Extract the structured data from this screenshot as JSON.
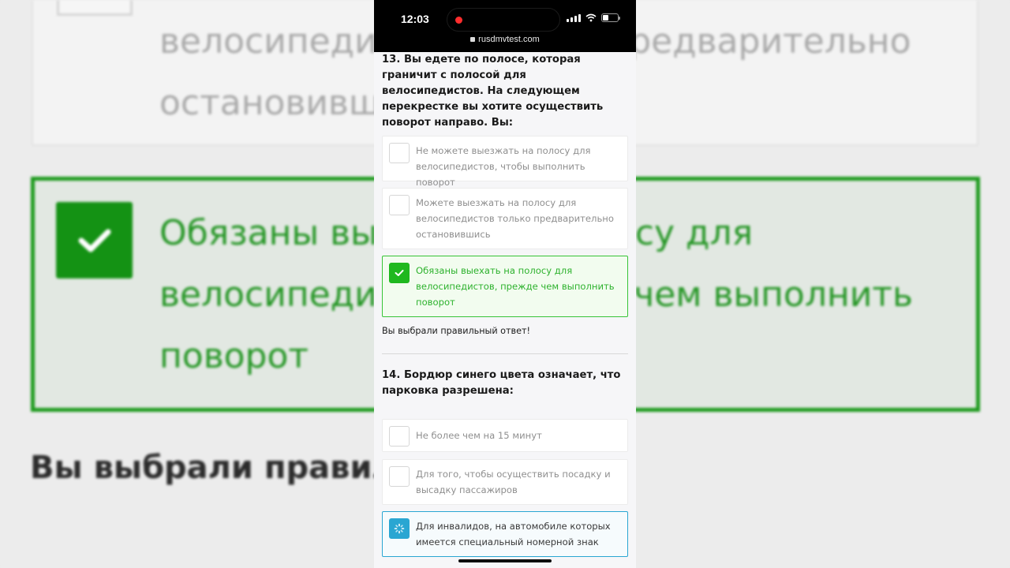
{
  "background": {
    "top_option_text": "велосипедистов только предварительно\nостановившись",
    "selected_option_text": "Обязаны выехать на полосу для\nвелосипедистов, прежде чем выполнить\nповорот",
    "feedback_text": "Вы выбрали правильный ответ!",
    "check_icon": "check-icon",
    "accent_color": "#1d9a1d"
  },
  "status_bar": {
    "time": "12:03",
    "recording_indicator": "red-dot",
    "url": "rusdmvtest.com"
  },
  "quiz": {
    "questions": [
      {
        "number_and_text": "13. Вы едете по полосе, которая граничит с полосой для велосипедистов. На следующем перекрестке вы хотите осуществить поворот направо. Вы:",
        "options": [
          {
            "text": "Не можете выезжать на полосу для велосипедистов, чтобы выполнить поворот",
            "state": "unchecked"
          },
          {
            "text": "Можете выезжать на полосу для велосипедистов только предварительно остановившись",
            "state": "unchecked"
          },
          {
            "text": "Обязаны выехать на полосу для велосипедистов, прежде чем выполнить поворот",
            "state": "correct"
          }
        ],
        "feedback": "Вы выбрали правильный ответ!"
      },
      {
        "number_and_text": "14. Бордюр синего цвета означает, что парковка разрешена:",
        "options": [
          {
            "text": "Не более чем на 15 минут",
            "state": "unchecked"
          },
          {
            "text": "Для того, чтобы осуществить посадку и высадку пассажиров",
            "state": "unchecked"
          },
          {
            "text": "Для инвалидов, на автомобиле которых имеется специальный номерной знак",
            "state": "loading"
          }
        ]
      }
    ]
  },
  "colors": {
    "correct_green": "#1fb81f",
    "selected_blue": "#2aa6d2"
  }
}
